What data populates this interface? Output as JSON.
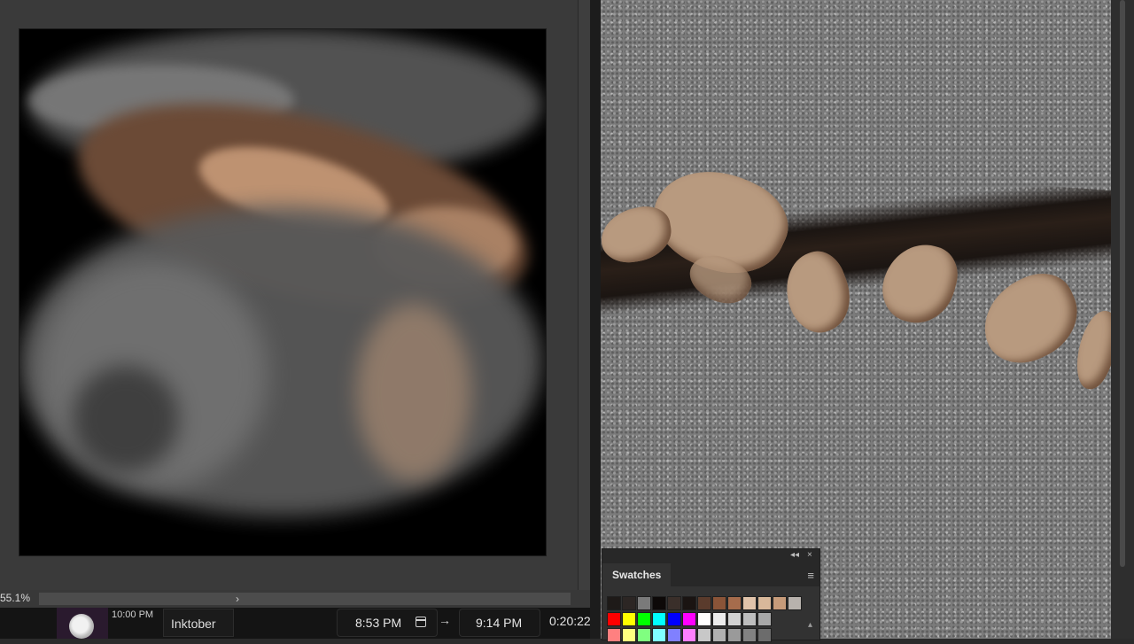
{
  "document_panel": {
    "zoom_readout": "55.1%",
    "scroll_arrow_glyph": "›"
  },
  "swatches_panel": {
    "tab_label": "Swatches",
    "collapse_glyph": "◂◂",
    "close_glyph": "×",
    "menu_glyph": "≡",
    "scroll_up_glyph": "▴",
    "rows": [
      [
        "#1e1a18",
        "#2c2624",
        "#7a7a7a",
        "#0d0908",
        "#3a2f2a",
        "#1a1412",
        "#5a3b2c",
        "#8a5438",
        "#a66c4c",
        "#e0c3aa",
        "#d8b89a",
        "#c69b7a",
        "#b8b2ad"
      ],
      [
        "#ff0000",
        "#ffff00",
        "#00ff00",
        "#00ffff",
        "#0000ff",
        "#ff00ff",
        "#ffffff",
        "#ececec",
        "#d2d2d2",
        "#bebebe",
        "#a8a8a8"
      ],
      [
        "#ff8080",
        "#ffff80",
        "#80ff80",
        "#80ffff",
        "#8080ff",
        "#ff80ff",
        "#c8c8c8",
        "#b0b0b0",
        "#9a9a9a",
        "#828282",
        "#6c6c6c"
      ]
    ]
  },
  "task_strip": {
    "start_time_small": "10:00 PM",
    "task_name": "Inktober",
    "start_time": "8:53 PM",
    "arrow_glyph": "→",
    "end_time": "9:14 PM",
    "duration": "0:20:22",
    "calendar_icon": "calendar-icon",
    "avatar_icon": "app-logo-icon"
  }
}
